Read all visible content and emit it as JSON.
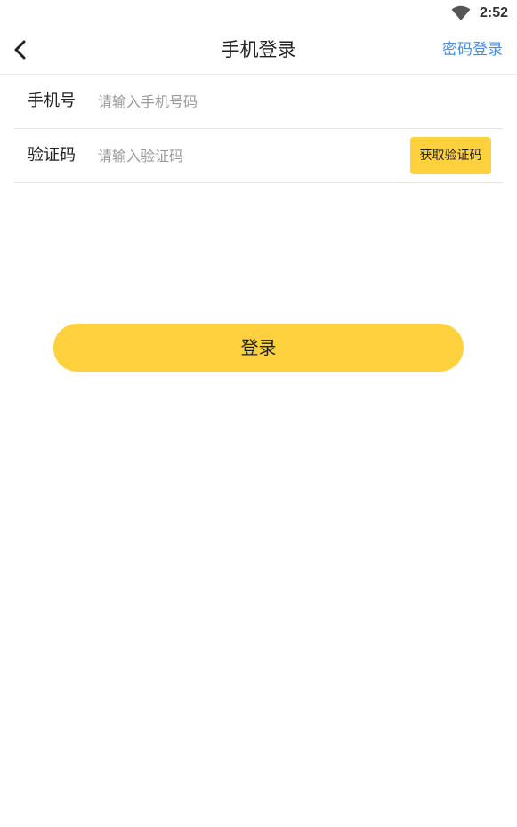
{
  "status_bar": {
    "time": "2:52",
    "wifi_icon": "wifi-icon"
  },
  "nav": {
    "back_icon": "chevron-left-icon",
    "title": "手机登录",
    "right_action": "密码登录"
  },
  "form": {
    "phone": {
      "label": "手机号",
      "value": "",
      "placeholder": "请输入手机号码"
    },
    "code": {
      "label": "验证码",
      "value": "",
      "placeholder": "请输入验证码",
      "send_button": "获取验证码"
    }
  },
  "login_button": "登录",
  "colors": {
    "accent": "#ffd13f",
    "link": "#4a90e2",
    "placeholder": "#9a9a9a",
    "divider": "#e6e6e6"
  }
}
